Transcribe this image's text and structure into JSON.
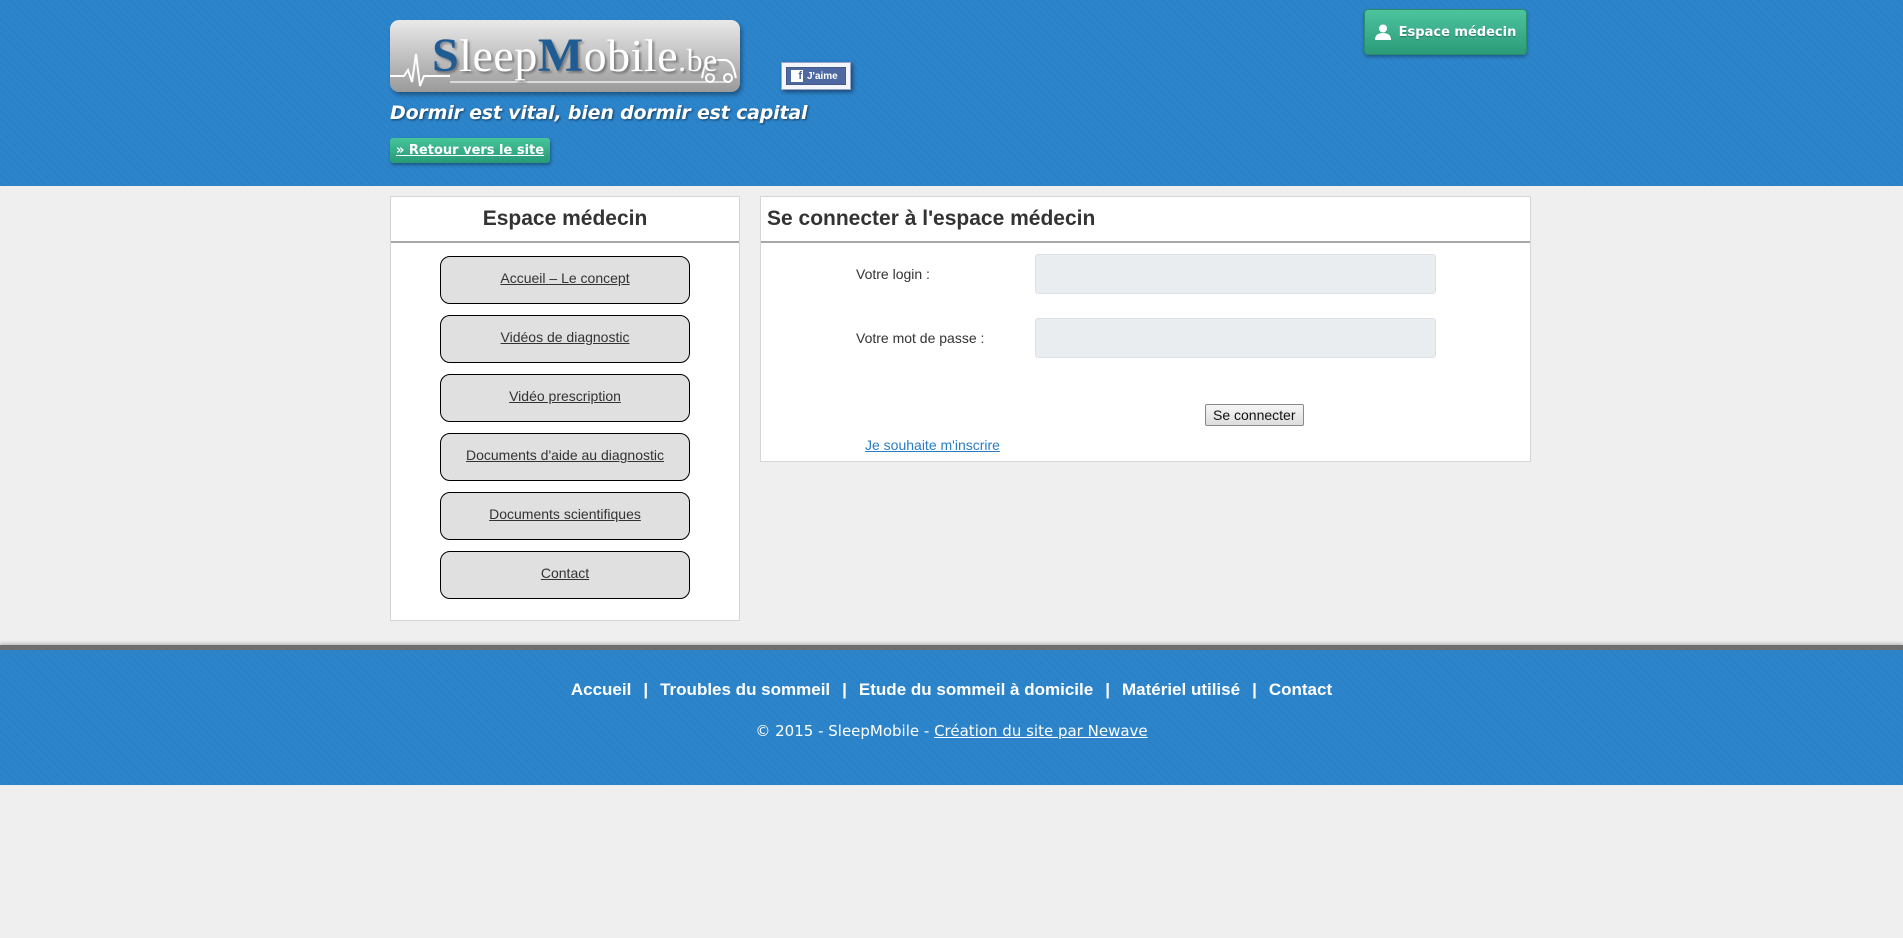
{
  "header": {
    "logo": {
      "prefix": "S",
      "mid1": "leep",
      "accent": "M",
      "mid2": "obile",
      "tld": ".be"
    },
    "facebook_like": "J'aime",
    "tagline": "Dormir est vital, bien dormir est capital",
    "back_link": "» Retour vers le site",
    "doctor_space_button": "Espace médecin"
  },
  "sidebar": {
    "title": "Espace médecin",
    "items": [
      {
        "label": "Accueil – Le concept"
      },
      {
        "label": "Vidéos de diagnostic"
      },
      {
        "label": "Vidéo prescription"
      },
      {
        "label": "Documents d'aide au diagnostic"
      },
      {
        "label": "Documents scientifiques"
      },
      {
        "label": "Contact"
      }
    ]
  },
  "login": {
    "title": "Se connecter à l'espace médecin",
    "login_label": "Votre login :",
    "login_value": "",
    "password_label": "Votre mot de passe :",
    "password_value": "",
    "submit": "Se connecter",
    "register_link": "Je souhaite m'inscrire"
  },
  "footer": {
    "nav": [
      {
        "label": "Accueil"
      },
      {
        "label": "Troubles du sommeil"
      },
      {
        "label": "Etude du sommeil à domicile"
      },
      {
        "label": "Matériel utilisé"
      },
      {
        "label": "Contact"
      }
    ],
    "separator": "|",
    "copyright": "© 2015 - SleepMobile - ",
    "credit": "Création du site par Newave"
  },
  "colors": {
    "header_blue": "#2a82c9",
    "accent_green": "#35b088",
    "page_background": "#efefef"
  }
}
